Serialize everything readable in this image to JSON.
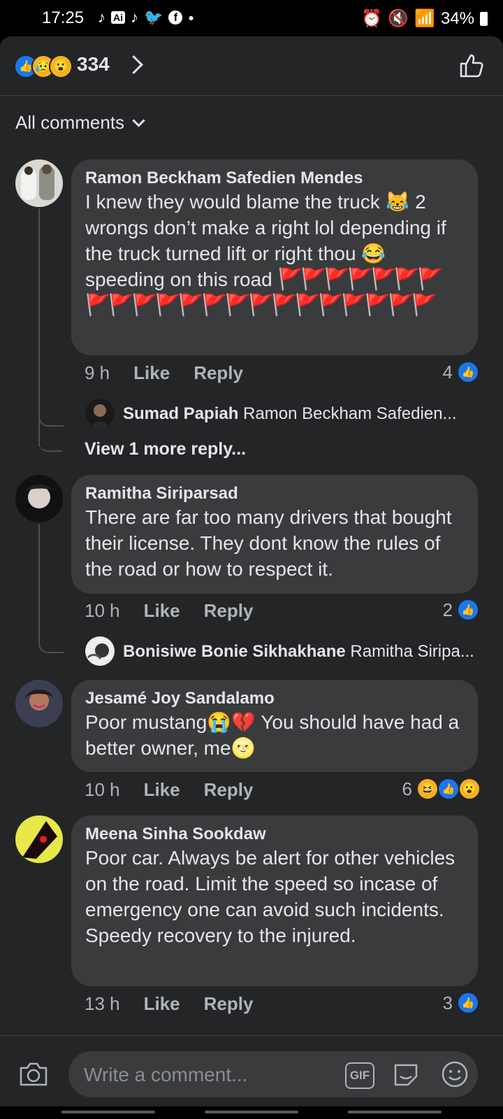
{
  "status_bar": {
    "time": "17:25",
    "ai_badge": "Ai",
    "battery": "34%"
  },
  "header": {
    "reaction_count": "334"
  },
  "filter": {
    "label": "All comments"
  },
  "comments": [
    {
      "author": "Ramon Beckham Safedien Mendes",
      "text": "I knew they would blame the truck 😹 2 wrongs don’t make a right lol depending if the truck turned lift or right thou 😂 speeding on this road",
      "flags": "🚩🚩🚩🚩🚩🚩🚩🚩🚩🚩🚩🚩🚩🚩🚩🚩🚩🚩🚩🚩🚩🚩",
      "time": "9 h",
      "like": "Like",
      "reply": "Reply",
      "reactions": "4",
      "replies": [
        {
          "author": "Sumad Papiah",
          "text": "Ramon Beckham Safedien..."
        }
      ],
      "view_more": "View 1 more reply..."
    },
    {
      "author": "Ramitha Siriparsad",
      "text": "There are far too many drivers that bought their license. They dont know the rules of the road or how to respect it.",
      "time": "10 h",
      "like": "Like",
      "reply": "Reply",
      "reactions": "2",
      "replies": [
        {
          "author": "Bonisiwe Bonie Sikhakhane",
          "text": "Ramitha Siripa..."
        }
      ]
    },
    {
      "author": "Jesamé Joy Sandalamo",
      "text": "Poor mustang😭💔   You should have had a better owner, me🌝",
      "time": "10 h",
      "like": "Like",
      "reply": "Reply",
      "reactions": "6"
    },
    {
      "author": "Meena Sinha Sookdaw",
      "text": "Poor car. Always be alert for other vehicles on the road. Limit the speed so incase of emergency one can avoid such incidents.\nSpeedy recovery to the injured.",
      "time": "13 h",
      "like": "Like",
      "reply": "Reply",
      "reactions": "3"
    }
  ],
  "composer": {
    "placeholder": "Write a comment...",
    "gif_label": "GIF"
  },
  "colors": {
    "background": "#242526",
    "bubble": "#3a3b3c",
    "like_blue": "#1877f2",
    "flag_red": "#e41e3f"
  },
  "icons": [
    "tiktok-icon",
    "twitter-icon",
    "facebook-icon",
    "alarm-icon",
    "mute-icon",
    "wifi-icon",
    "signal-icon",
    "battery-icon",
    "thumbs-up-outline-icon",
    "chevron-right-icon",
    "chevron-down-icon",
    "camera-icon",
    "gif-icon",
    "sticker-icon",
    "emoji-icon"
  ]
}
